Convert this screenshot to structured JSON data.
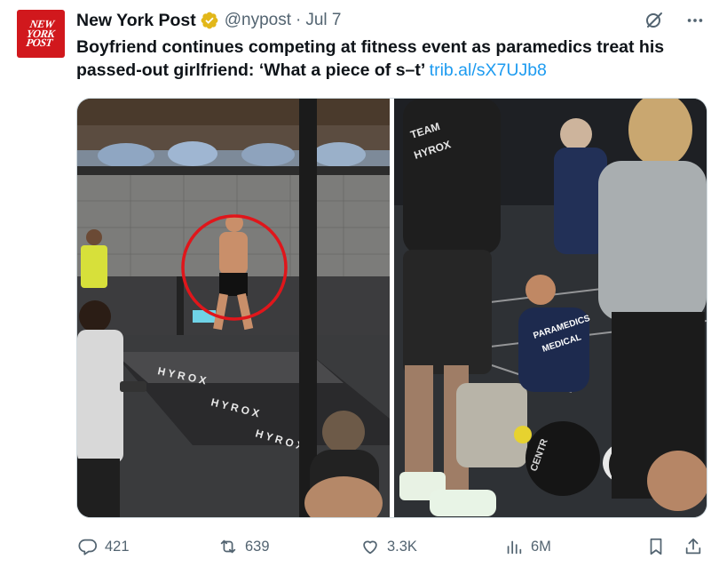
{
  "account": {
    "avatar_text": "NEW YORK POST",
    "display_name": "New York Post",
    "handle": "@nypost",
    "separator": "·",
    "date": "Jul 7"
  },
  "tweet": {
    "text": "Boyfriend continues competing at fitness event as paramedics treat his passed-out girlfriend: ‘What a piece of s–t’ ",
    "link": "trib.al/sX7UJb8"
  },
  "media": {
    "photos": [
      {
        "description_icon": "photo",
        "signage": "HYROX"
      },
      {
        "description_icon": "photo",
        "shirt_text": "TEAM HYROX",
        "paramedic_text": "PARAMEDICS MEDICAL",
        "ball_text": "CENTR"
      }
    ]
  },
  "actions": {
    "replies": "421",
    "reposts": "639",
    "likes": "3.3K",
    "views": "6M"
  },
  "colors": {
    "brand_red": "#d1181d",
    "link": "#1d9bf0",
    "verified_gold": "#e2b719",
    "icon_gray": "#536471",
    "highlight_circle": "#e0161b"
  },
  "icons": [
    "verified-badge-icon",
    "grok-icon",
    "more-icon",
    "reply-icon",
    "repost-icon",
    "like-icon",
    "views-icon",
    "bookmark-icon",
    "share-icon"
  ]
}
